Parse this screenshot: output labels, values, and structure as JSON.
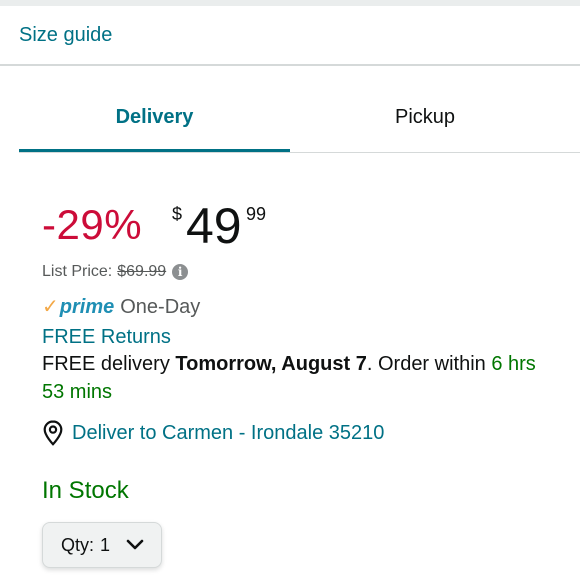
{
  "links": {
    "size_guide": "Size guide"
  },
  "tabs": [
    {
      "label": "Delivery",
      "active": true
    },
    {
      "label": "Pickup",
      "active": false
    }
  ],
  "price": {
    "discount": "-29%",
    "currency": "$",
    "whole": "49",
    "fraction": "99",
    "list_price_label": "List Price:",
    "list_price_value": "$69.99"
  },
  "prime": {
    "badge": "prime",
    "speed": "One-Day"
  },
  "returns": "FREE Returns",
  "delivery": {
    "prefix": "FREE delivery ",
    "date": "Tomorrow, August 7",
    "order_within_prefix": ". Order within ",
    "countdown": "6 hrs 53 mins"
  },
  "location": {
    "text": "Deliver to Carmen - Irondale 35210",
    "icon": "location-pin-icon"
  },
  "stock": {
    "status": "In Stock"
  },
  "quantity": {
    "label": "Qty:",
    "value": "1"
  },
  "colors": {
    "link": "#007185",
    "discount": "#cc0c39",
    "in_stock": "#007600",
    "prime_check": "#f3a847",
    "prime_blue": "#1f8fb4"
  }
}
